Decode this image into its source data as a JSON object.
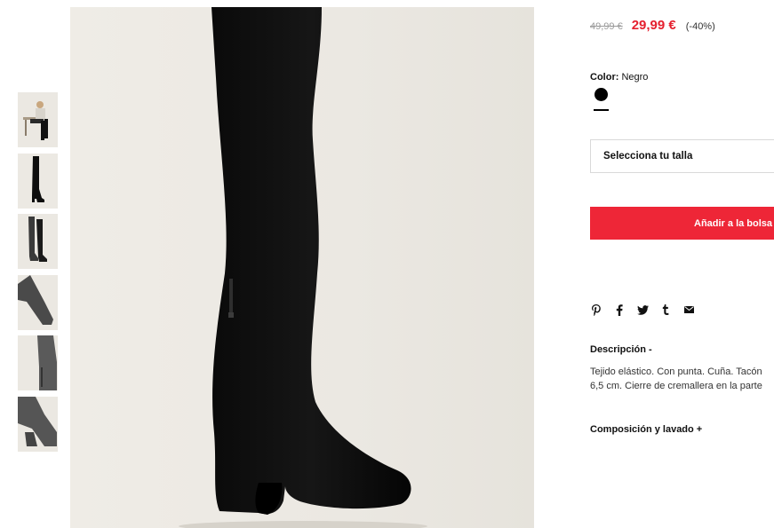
{
  "product": {
    "old_price": "49,99 €",
    "sale_price": "29,99 €",
    "discount": "(-40%)",
    "color_label": "Color:",
    "color_value": "Negro",
    "swatch_color": "#000000",
    "size_placeholder": "Selecciona tu talla",
    "add_to_bag": "Añadir a la bolsa",
    "accent_color": "#ee2637",
    "price_color": "#e5202e"
  },
  "share": {
    "icons": [
      "pinterest-icon",
      "facebook-icon",
      "twitter-icon",
      "tumblr-icon",
      "email-icon"
    ]
  },
  "description": {
    "title": "Descripción -",
    "line1": "Tejido elástico. Con punta. Cuña. Tacón",
    "line2": "6,5 cm. Cierre de cremallera en la parte"
  },
  "composition": {
    "title": "Composición y lavado +"
  },
  "gallery": {
    "thumbnails": [
      "model-seated",
      "boot-full-side",
      "boot-pair",
      "boot-toe-detail",
      "boot-shaft-detail",
      "boot-heel-detail"
    ]
  }
}
